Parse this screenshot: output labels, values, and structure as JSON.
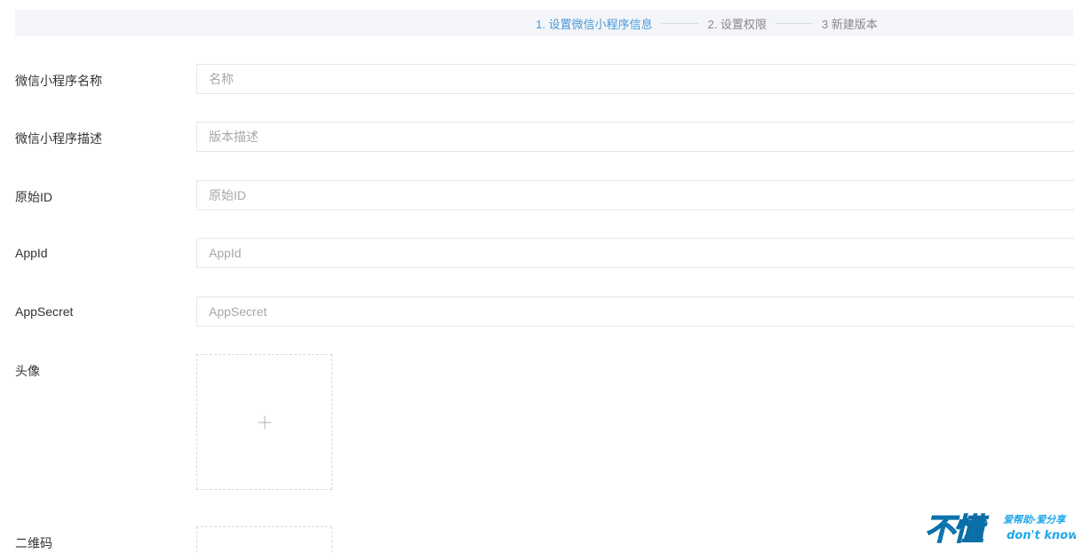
{
  "steps": [
    {
      "label": "1. 设置微信小程序信息",
      "active": true
    },
    {
      "label": "2. 设置权限",
      "active": false
    },
    {
      "label": "3 新建版本",
      "active": false
    }
  ],
  "form": {
    "name": {
      "label": "微信小程序名称",
      "placeholder": "名称",
      "value": ""
    },
    "description": {
      "label": "微信小程序描述",
      "placeholder": "版本描述",
      "value": ""
    },
    "original_id": {
      "label": "原始ID",
      "placeholder": "原始ID",
      "value": ""
    },
    "app_id": {
      "label": "AppId",
      "placeholder": "AppId",
      "value": ""
    },
    "app_secret": {
      "label": "AppSecret",
      "placeholder": "AppSecret",
      "value": ""
    },
    "avatar": {
      "label": "头像",
      "icon": "plus-icon"
    },
    "qrcode": {
      "label": "二维码"
    }
  },
  "watermark": {
    "main": "不懂",
    "tagline": "爱帮助·爱分享",
    "sub": "don't know"
  },
  "colors": {
    "active_step": "#4a9ad8",
    "inactive_step": "#888888",
    "steps_bar_bg": "#f3f5f9",
    "input_border": "#e4e6ea",
    "placeholder": "#a8a8a8",
    "watermark_blue": "#1ea7e8"
  }
}
